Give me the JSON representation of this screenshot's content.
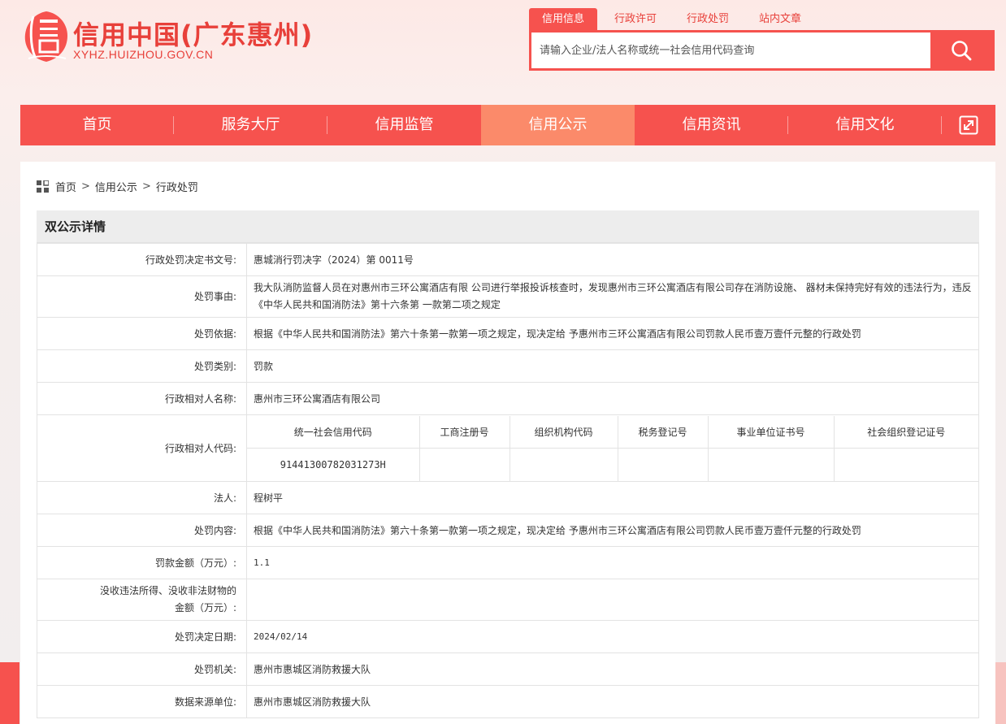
{
  "header": {
    "site_title": "信用中国(广东惠州)",
    "site_domain": "XYHZ.HUIZHOU.GOV.CN",
    "logo_icon": "credit-seal-logo",
    "brand_color": "#f6524e"
  },
  "search": {
    "tabs": [
      "信用信息",
      "行政许可",
      "行政处罚",
      "站内文章"
    ],
    "placeholder": "请输入企业/法人名称或统一社会信用代码查询",
    "button_icon": "search-icon"
  },
  "nav": {
    "items": [
      "首页",
      "服务大厅",
      "信用监管",
      "信用公示",
      "信用资讯",
      "信用文化"
    ],
    "active": "信用公示",
    "expand_icon": "expand-icon"
  },
  "breadcrumb": {
    "icon": "grid-icon",
    "items": [
      "首页",
      "信用公示",
      "行政处罚"
    ],
    "separator": ">"
  },
  "section": {
    "title": "双公示详情"
  },
  "details": {
    "decision_no_label": "行政处罚决定书文号:",
    "decision_no": "惠城消行罚决字（2024）第 0011号",
    "reason_label": "处罚事由:",
    "reason": "我大队消防监督人员在对惠州市三环公寓酒店有限 公司进行举报投诉核查时，发现惠州市三环公寓酒店有限公司存在消防设施、 器材未保持完好有效的违法行为，违反《中华人民共和国消防法》第十六条第 一款第二项之规定",
    "basis_label": "处罚依据:",
    "basis": "根据《中华人民共和国消防法》第六十条第一款第一项之规定，现决定给 予惠州市三环公寓酒店有限公司罚款人民币壹万壹仟元整的行政处罚",
    "category_label": "处罚类别:",
    "category": "罚款",
    "party_name_label": "行政相对人名称:",
    "party_name": "惠州市三环公寓酒店有限公司",
    "party_code_label": "行政相对人代码:",
    "code_headers": [
      "统一社会信用代码",
      "工商注册号",
      "组织机构代码",
      "税务登记号",
      "事业单位证书号",
      "社会组织登记证号"
    ],
    "code_values": [
      "91441300782031273H",
      "",
      "",
      "",
      "",
      ""
    ],
    "legal_person_label": "法人:",
    "legal_person": "程树平",
    "content_label": "处罚内容:",
    "content": "根据《中华人民共和国消防法》第六十条第一款第一项之规定，现决定给 予惠州市三环公寓酒店有限公司罚款人民币壹万壹仟元整的行政处罚",
    "fine_label": "罚款金额（万元）:",
    "fine": "1.1",
    "confiscation_label_1": "没收违法所得、没收非法财物的",
    "confiscation_label_2": "金额（万元）:",
    "confiscation": "",
    "date_label": "处罚决定日期:",
    "date": "2024/02/14",
    "authority_label": "处罚机关:",
    "authority": "惠州市惠城区消防救援大队",
    "source_label": "数据来源单位:",
    "source": "惠州市惠城区消防救援大队"
  }
}
